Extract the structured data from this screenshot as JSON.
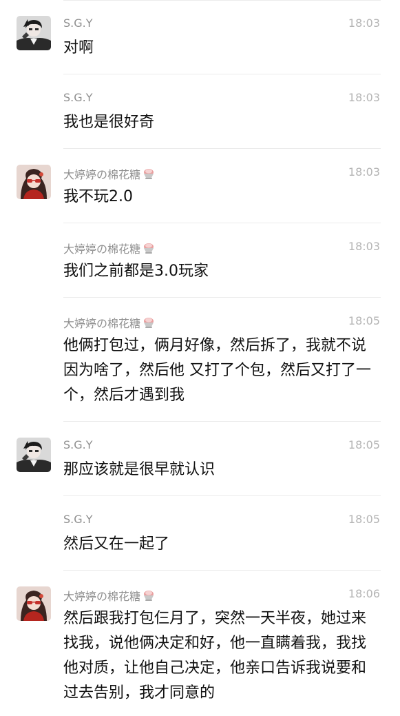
{
  "messages": [
    {
      "sender": "S.G.Y",
      "time": "18:03",
      "text": "对啊",
      "avatar": "male-avatar"
    },
    {
      "sender": "S.G.Y",
      "time": "18:03",
      "text": "我也是很好奇",
      "avatar": ""
    },
    {
      "sender": "大婷婷の棉花糖",
      "time": "18:03",
      "text": "我不玩2.0",
      "avatar": "female-avatar"
    },
    {
      "sender": "大婷婷の棉花糖",
      "time": "18:03",
      "text": "我们之前都是3.0玩家",
      "avatar": ""
    },
    {
      "sender": "大婷婷の棉花糖",
      "time": "18:05",
      "text": "他俩打包过，俩月好像，然后拆了，我就不说因为啥了，然后他 又打了个包，然后又打了一个，然后才遇到我",
      "avatar": ""
    },
    {
      "sender": "S.G.Y",
      "time": "18:05",
      "text": "那应该就是很早就认识",
      "avatar": "male-avatar"
    },
    {
      "sender": "S.G.Y",
      "time": "18:05",
      "text": "然后又在一起了",
      "avatar": ""
    },
    {
      "sender": "大婷婷の棉花糖",
      "time": "18:06",
      "text": "然后跟我打包仨月了，突然一天半夜，她过来找我，说他俩决定和好，他一直瞒着我，我找他对质，让他自己决定，他亲口告诉我说要和过去告别，我才同意的",
      "avatar": "female-avatar"
    }
  ],
  "icons": {
    "name_suffix_emoji": "shaved-ice-emoji"
  },
  "colors": {
    "background": "#ffffff",
    "sender": "#8f8f8f",
    "time": "#b4b4b4",
    "text": "#111111",
    "divider": "#ebebeb"
  }
}
